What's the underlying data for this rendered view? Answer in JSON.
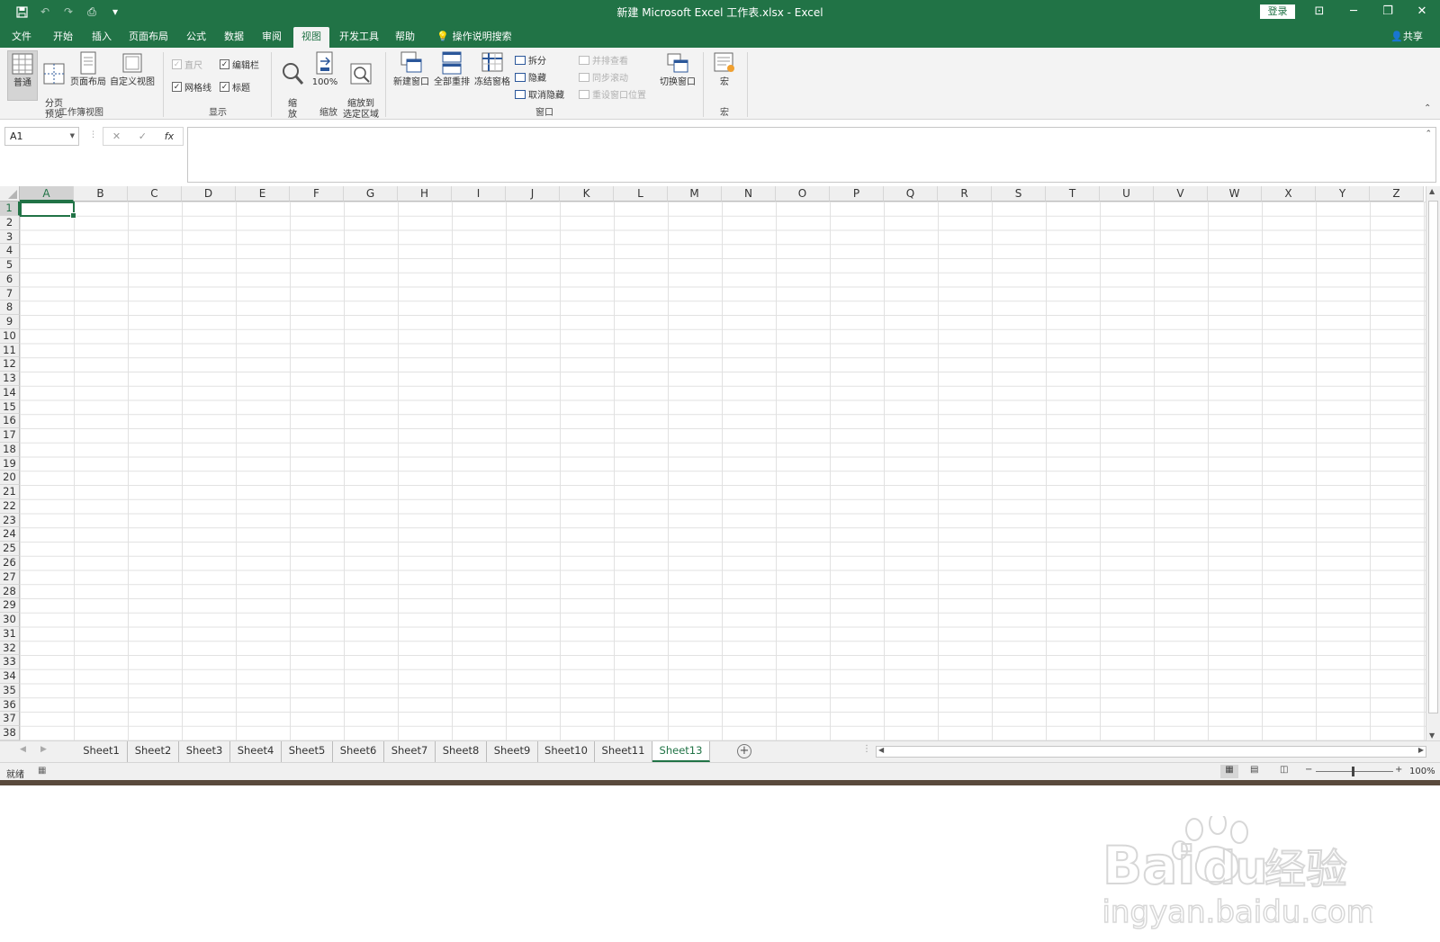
{
  "window": {
    "title": "新建 Microsoft Excel 工作表.xlsx  -  Excel",
    "login_label": "登录"
  },
  "qat": {
    "save": "save-icon",
    "undo": "undo-icon",
    "redo": "redo-icon",
    "more": "▾"
  },
  "menu": {
    "tabs": [
      "文件",
      "开始",
      "插入",
      "页面布局",
      "公式",
      "数据",
      "审阅",
      "视图",
      "开发工具",
      "帮助"
    ],
    "active_tab": "视图",
    "tellme": "操作说明搜索",
    "share": "共享"
  },
  "ribbon": {
    "workbook_views": {
      "label": "工作簿视图",
      "normal": "普通",
      "page_break": "分页\n预览",
      "page_layout": "页面布局",
      "custom": "自定义视图"
    },
    "show": {
      "label": "显示",
      "ruler": "直尺",
      "formula_bar": "编辑栏",
      "gridlines": "网格线",
      "headings": "标题"
    },
    "zoom": {
      "label": "缩放",
      "zoom": "缩\n放",
      "hundred": "100%",
      "zoom_sel": "缩放到\n选定区域"
    },
    "window": {
      "label": "窗口",
      "new_window": "新建窗口",
      "arrange_all": "全部重排",
      "freeze": "冻结窗格",
      "split": "拆分",
      "hide": "隐藏",
      "unhide": "取消隐藏",
      "side_by_side": "并排查看",
      "sync_scroll": "同步滚动",
      "reset_pos": "重设窗口位置",
      "switch": "切换窗口"
    },
    "macro": {
      "label": "宏",
      "macro": "宏"
    }
  },
  "formula": {
    "namebox": "A1",
    "cancel": "✕",
    "enter": "✓",
    "fx": "fx",
    "value": ""
  },
  "grid": {
    "columns": [
      "A",
      "B",
      "C",
      "D",
      "E",
      "F",
      "G",
      "H",
      "I",
      "J",
      "K",
      "L",
      "M",
      "N",
      "O",
      "P",
      "Q",
      "R",
      "S",
      "T",
      "U",
      "V",
      "W",
      "X",
      "Y",
      "Z"
    ],
    "rows": [
      "1",
      "2",
      "3",
      "4",
      "5",
      "6",
      "7",
      "8",
      "9",
      "10",
      "11",
      "12",
      "13",
      "14",
      "15",
      "16",
      "17",
      "18",
      "19",
      "20",
      "21",
      "22",
      "23",
      "24",
      "25",
      "26",
      "27",
      "28",
      "29",
      "30",
      "31",
      "32",
      "33",
      "34",
      "35",
      "36",
      "37",
      "38"
    ],
    "active_col": "A",
    "active_row": "1"
  },
  "sheets": {
    "tabs": [
      "Sheet1",
      "Sheet2",
      "Sheet3",
      "Sheet4",
      "Sheet5",
      "Sheet6",
      "Sheet7",
      "Sheet8",
      "Sheet9",
      "Sheet10",
      "Sheet11",
      "Sheet13"
    ],
    "active": "Sheet13",
    "add": "+"
  },
  "status": {
    "ready": "就绪",
    "zoom": "100%"
  },
  "watermark": {
    "text1": "Bai",
    "text2": "du",
    "text3": "经验",
    "url": "jingyan.baidu.com"
  },
  "colors": {
    "accent": "#217346"
  }
}
